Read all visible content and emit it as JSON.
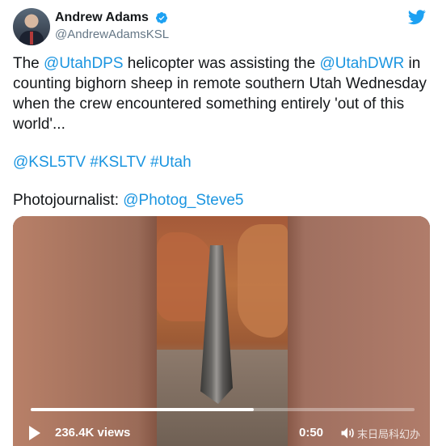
{
  "author": {
    "display_name": "Andrew Adams",
    "handle": "@AndrewAdamsKSL",
    "verified": true
  },
  "tweet": {
    "line1_prefix": "The ",
    "mention_dps": "@UtahDPS",
    "line1_mid": " helicopter was assisting the ",
    "mention_dwr": "@UtahDWR",
    "line1_rest": " in counting bighorn sheep in remote southern Utah Wednesday when the crew encountered something entirely 'out of this world'...",
    "mention_ksl5tv": "@KSL5TV",
    "hashtag_ksltv": "#KSLTV",
    "hashtag_utah": "#Utah",
    "photo_label": "Photojournalist: ",
    "mention_photog": "@Photog_Steve5"
  },
  "video": {
    "views": "236.4K views",
    "time": "0:50",
    "progress": 0.58,
    "watermark": "末日局科幻办"
  },
  "colors": {
    "link": "#1b95e0",
    "twitter_blue": "#1da1f2"
  },
  "icons": [
    "verified-badge-icon",
    "twitter-bird-icon",
    "play-icon",
    "sound-icon"
  ]
}
